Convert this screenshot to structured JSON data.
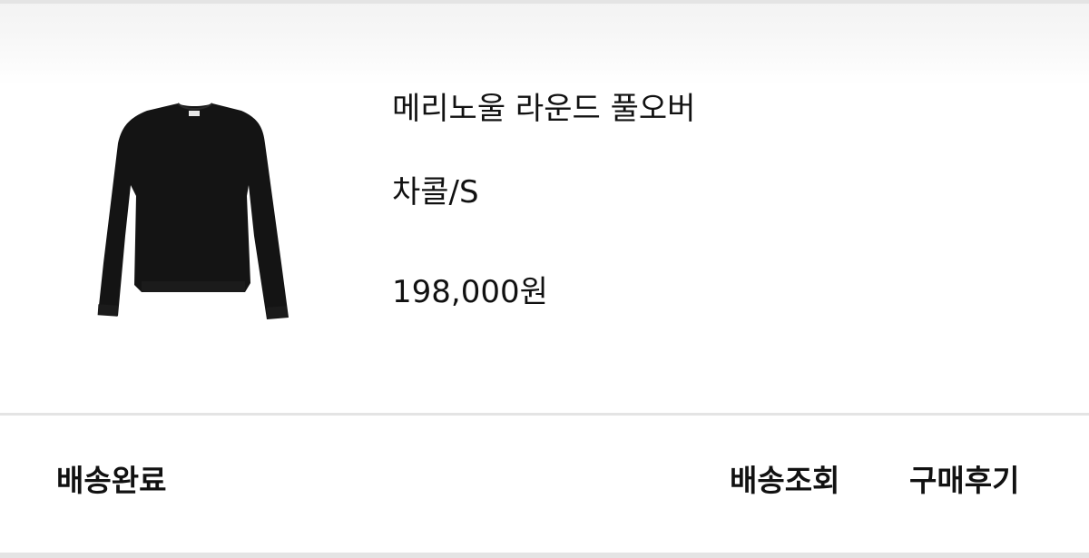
{
  "order_item": {
    "image_icon": "sweater-product-image",
    "name": "메리노울 라운드 풀오버",
    "option": "차콜/S",
    "price": "198,000원"
  },
  "footer": {
    "status": "배송완료",
    "actions": {
      "track_label": "배송조회",
      "review_label": "구매후기"
    }
  },
  "colors": {
    "text": "#111111",
    "divider": "#e4e4e4",
    "sweater": "#141414",
    "background": "#ffffff"
  }
}
